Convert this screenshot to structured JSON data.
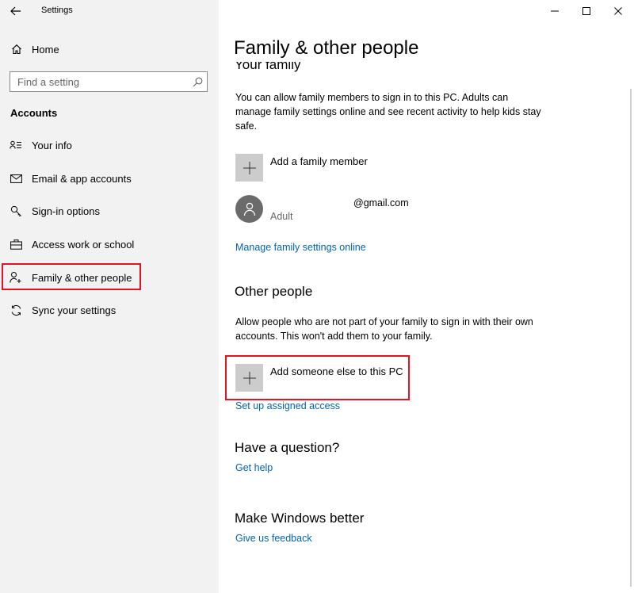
{
  "window": {
    "app_title": "Settings",
    "controls": {
      "minimize": "minimize-icon",
      "maximize": "maximize-icon",
      "close": "close-icon"
    }
  },
  "sidebar": {
    "home_label": "Home",
    "search": {
      "placeholder": "Find a setting",
      "value": ""
    },
    "section_title": "Accounts",
    "items": [
      {
        "label": "Your info",
        "icon": "contact-card-icon"
      },
      {
        "label": "Email & app accounts",
        "icon": "mail-icon"
      },
      {
        "label": "Sign-in options",
        "icon": "key-icon"
      },
      {
        "label": "Access work or school",
        "icon": "briefcase-icon"
      },
      {
        "label": "Family & other people",
        "icon": "add-person-icon",
        "selected": true
      },
      {
        "label": "Sync your settings",
        "icon": "sync-icon"
      }
    ]
  },
  "main": {
    "title": "Family & other people",
    "family": {
      "heading": "Your family",
      "description": "You can allow family members to sign in to this PC. Adults can manage family settings online and see recent activity to help kids stay safe.",
      "add_label": "Add a family member",
      "account": {
        "email": "@gmail.com",
        "role": "Adult"
      },
      "manage_link": "Manage family settings online"
    },
    "other": {
      "heading": "Other people",
      "description": "Allow people who are not part of your family to sign in with their own accounts. This won't add them to your family.",
      "add_label": "Add someone else to this PC",
      "assigned_link": "Set up assigned access"
    },
    "question": {
      "heading": "Have a question?",
      "link": "Get help"
    },
    "better": {
      "heading": "Make Windows better",
      "link": "Give us feedback"
    }
  },
  "colors": {
    "accent_link": "#0063b1",
    "highlight": "#e81123",
    "sidebar_bg": "#f2f2f2"
  }
}
